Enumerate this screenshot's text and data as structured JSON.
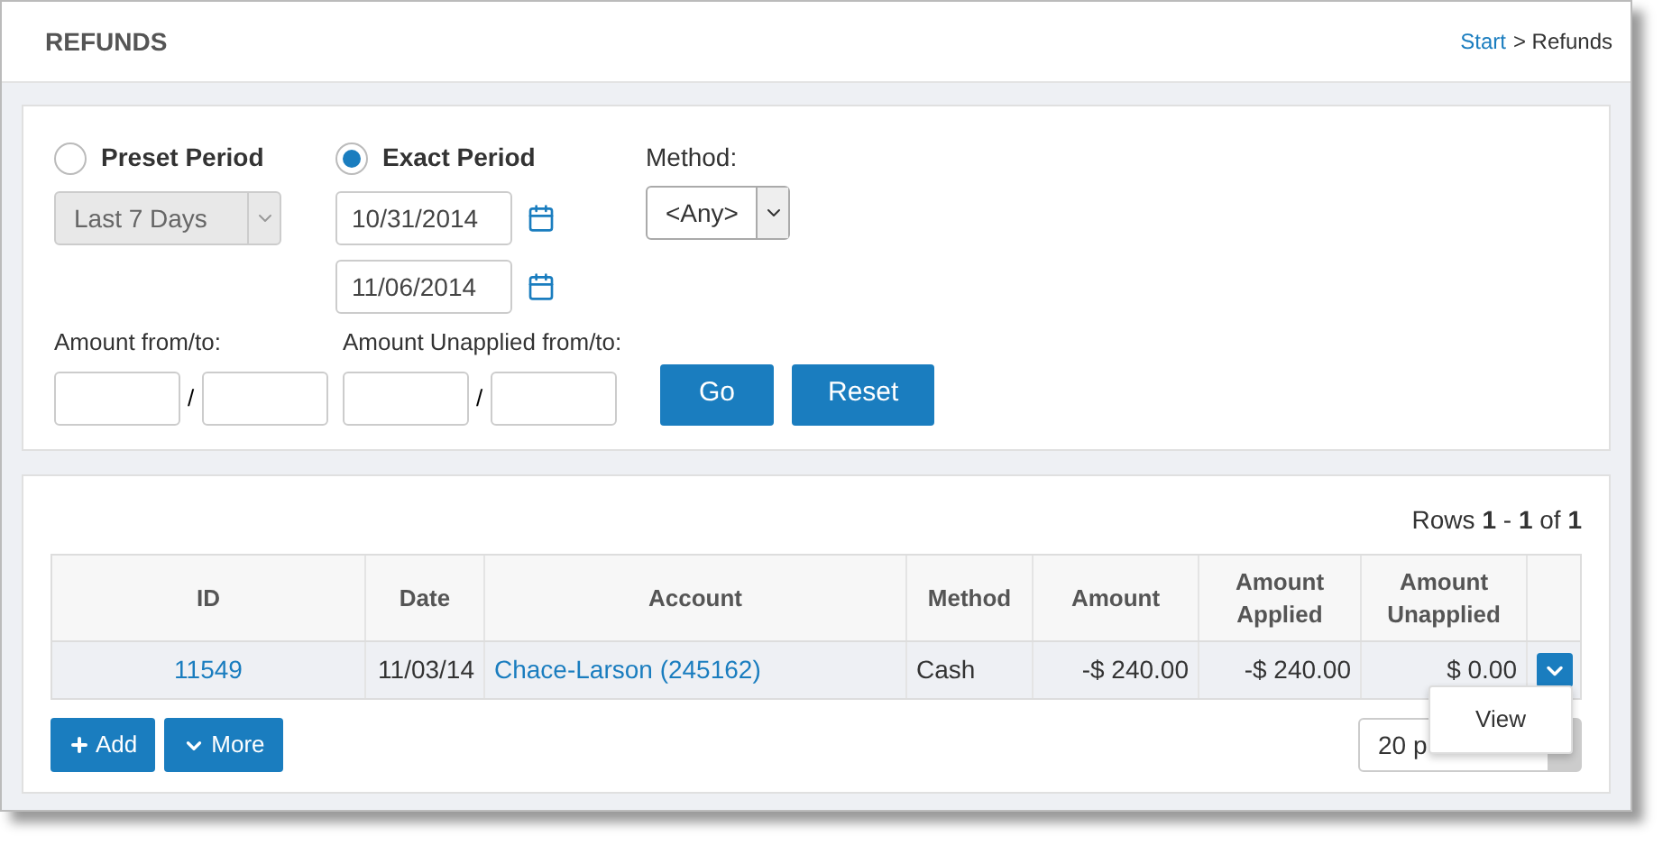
{
  "header": {
    "title": "REFUNDS",
    "breadcrumb": {
      "link": "Start",
      "current": "> Refunds"
    }
  },
  "filters": {
    "period_options": [
      {
        "label": "Preset Period",
        "selected": false
      },
      {
        "label": "Exact Period",
        "selected": true
      }
    ],
    "preset_select": {
      "value": "Last 7 Days",
      "disabled": true
    },
    "date_from": "10/31/2014",
    "date_to": "11/06/2014",
    "method": {
      "label": "Method:",
      "value": "<Any>"
    },
    "amount": {
      "label": "Amount from/to:",
      "separator": "/"
    },
    "amount_unapplied": {
      "label": "Amount Unapplied from/to:",
      "separator": "/"
    },
    "buttons": [
      "Go",
      "Reset"
    ]
  },
  "table": {
    "rows_info": {
      "prefix": "Rows",
      "from": "1",
      "dash": "-",
      "to": "1",
      "of": "of",
      "total": "1"
    },
    "columns": [
      {
        "label": "ID"
      },
      {
        "label": "Date"
      },
      {
        "label": "Account"
      },
      {
        "label": "Method"
      },
      {
        "label": "Amount"
      },
      {
        "label": "Amount Applied"
      },
      {
        "label": "Amount Unapplied"
      }
    ],
    "rows": [
      {
        "id": "11549",
        "date": "11/03/14",
        "account": "Chace-Larson (245162)",
        "method": "Cash",
        "amount": "-$ 240.00",
        "amount_applied": "-$ 240.00",
        "amount_unapplied": "$ 0.00"
      }
    ],
    "row_menu": {
      "items": [
        "View"
      ]
    },
    "actions": [
      "Add",
      "More"
    ],
    "page_size": "20 p"
  }
}
